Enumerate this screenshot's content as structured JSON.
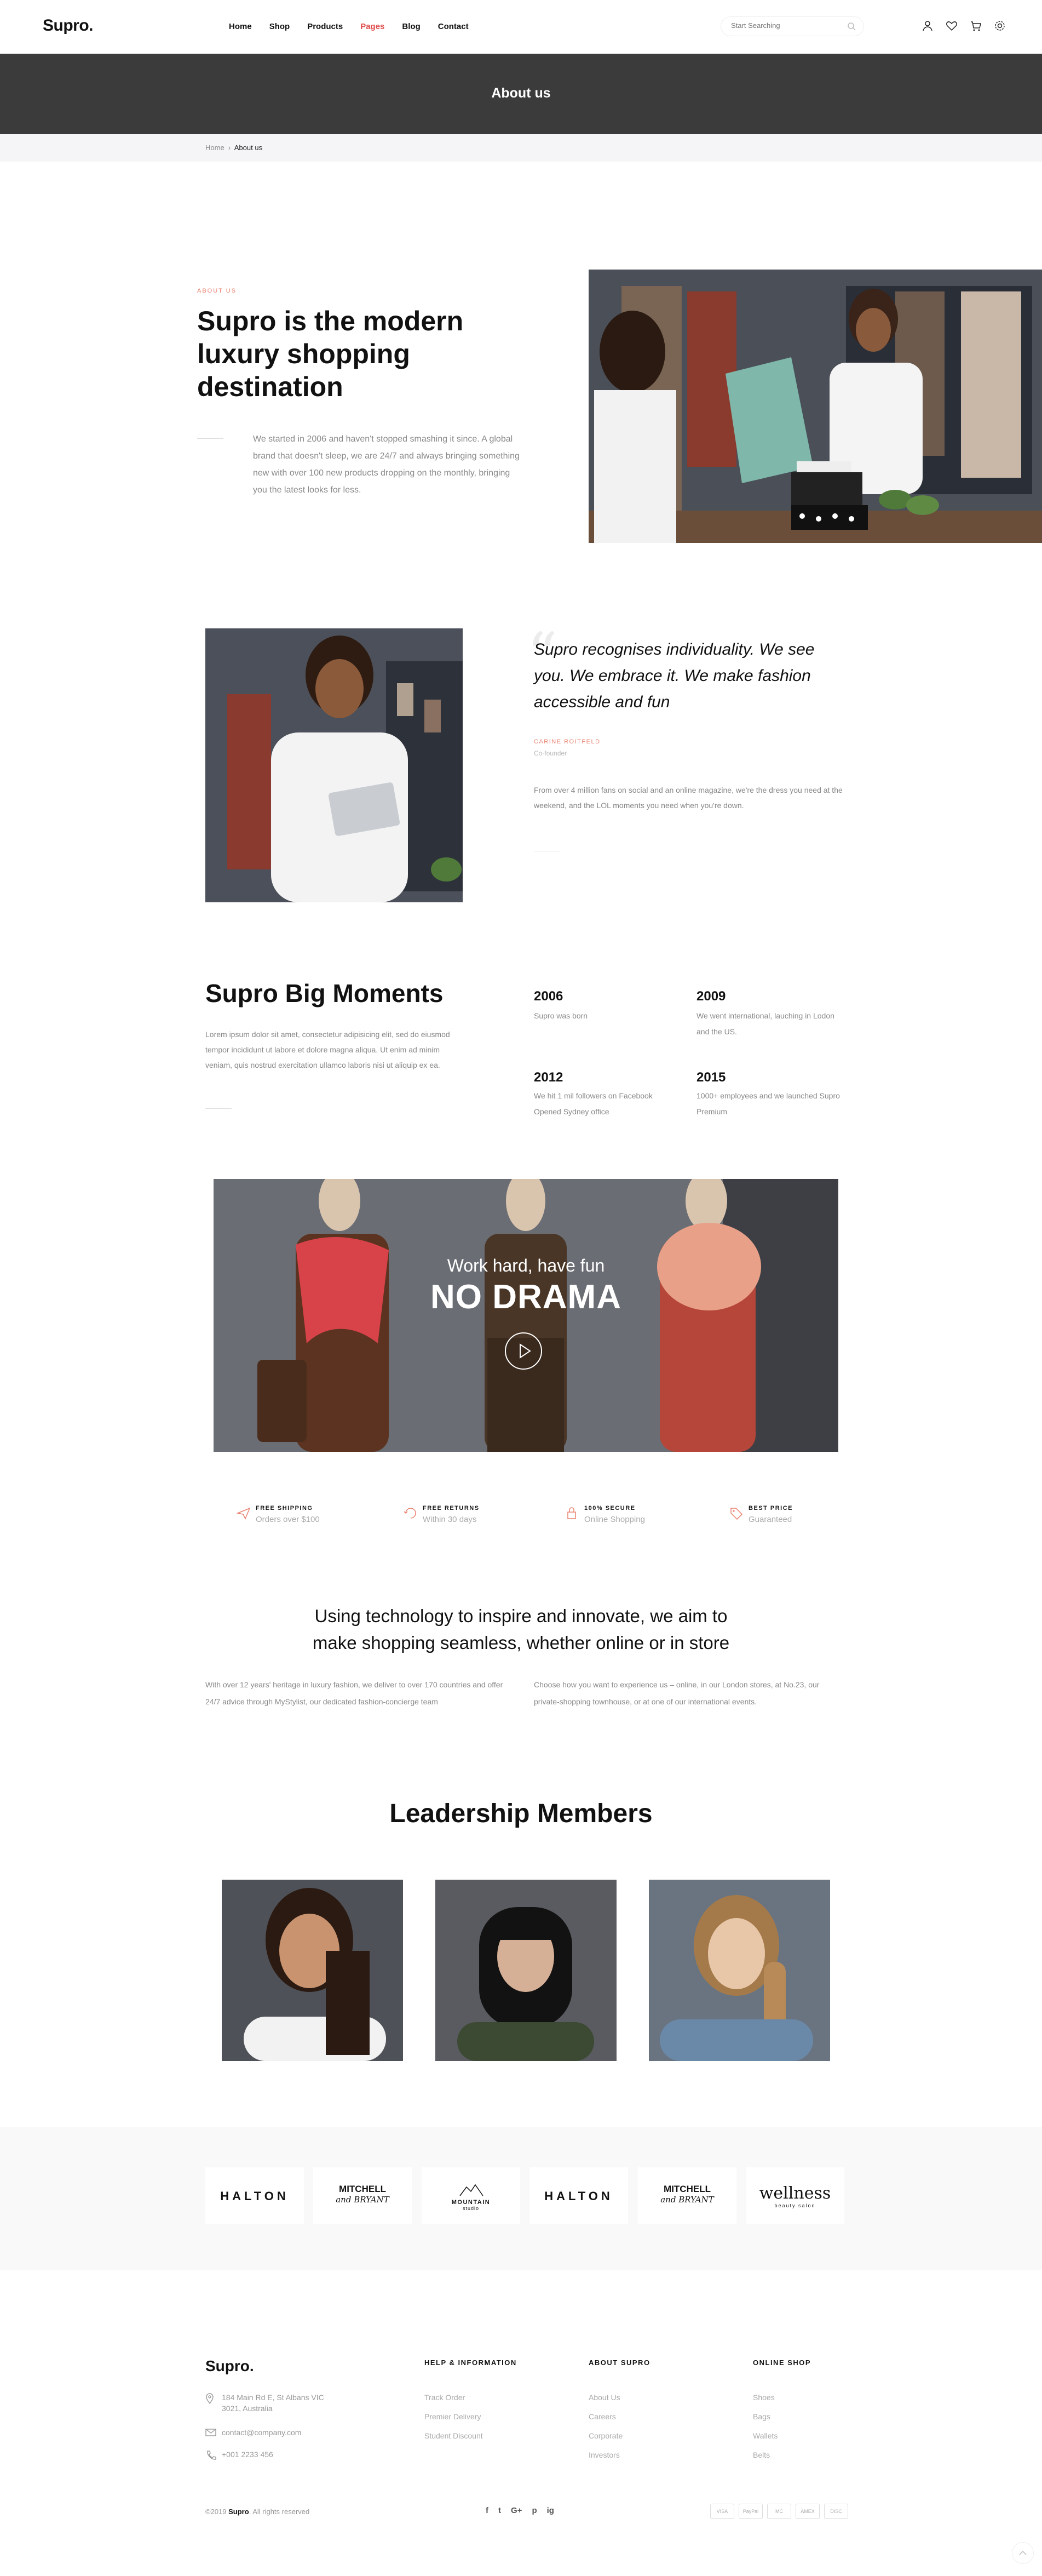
{
  "header": {
    "logo": "Supro.",
    "nav": [
      "Home",
      "Shop",
      "Products",
      "Pages",
      "Blog",
      "Contact"
    ],
    "nav_active": "Pages",
    "search_placeholder": "Start Searching",
    "icons": [
      "user-icon",
      "heart-icon",
      "cart-icon",
      "settings-icon"
    ]
  },
  "page": {
    "title": "About us",
    "breadcrumb": [
      "Home",
      "About us"
    ]
  },
  "about": {
    "eyebrow": "ABOUT US",
    "heading": "Supro is the modern luxury shopping destination",
    "body": "We started in 2006 and haven't stopped smashing it since. A global brand that doesn't sleep, we are 24/7 and always bringing something new with over 100 new products dropping on the monthly, bringing you the latest looks for less."
  },
  "quote": {
    "text": "Supro recognises individuality. We see you. We embrace it. We make fashion accessible and fun",
    "name": "CARINE ROITFELD",
    "role": "Co-founder",
    "body": "From over 4 million fans on social and an online magazine, we're the dress you need at the weekend, and the LOL moments you need when you're down."
  },
  "moments": {
    "heading": "Supro Big Moments",
    "body": "Lorem ipsum dolor sit amet, consectetur adipisicing elit, sed do eiusmod tempor incididunt ut labore et dolore magna aliqua. Ut enim ad minim veniam, quis nostrud exercitation ullamco laboris nisi ut aliquip ex ea.",
    "items": [
      {
        "year": "2006",
        "text": "Supro was born"
      },
      {
        "year": "2009",
        "text": "We went international, lauching in Lodon and the US."
      },
      {
        "year": "2012",
        "text": "We hit 1 mil followers on Facebook Opened Sydney office"
      },
      {
        "year": "2015",
        "text": "1000+ employees and we launched Supro Premium"
      }
    ]
  },
  "video": {
    "subtitle": "Work hard, have fun",
    "title": "NO DRAMA"
  },
  "features": [
    {
      "title": "FREE SHIPPING",
      "sub": "Orders over $100",
      "icon": "plane-icon"
    },
    {
      "title": "FREE RETURNS",
      "sub": "Within 30 days",
      "icon": "return-icon"
    },
    {
      "title": "100% SECURE",
      "sub": "Online Shopping",
      "icon": "lock-icon"
    },
    {
      "title": "BEST PRICE",
      "sub": "Guaranteed",
      "icon": "tag-icon"
    }
  ],
  "tech": {
    "heading": "Using technology to inspire and innovate, we aim to make shopping seamless, whether online or in store",
    "left": "With over 12 years' heritage in luxury fashion, we deliver to over 170 countries and offer 24/7 advice through MyStylist, our dedicated fashion-concierge team",
    "right": "Choose how you want to experience us – online, in our London stores, at No.23, our private-shopping townhouse, or at one of our international events."
  },
  "leadership": {
    "heading": "Leadership Members"
  },
  "brands": [
    {
      "line1": "HALTON",
      "line2": ""
    },
    {
      "line1": "MITCHELL",
      "line2": "and BRYANT"
    },
    {
      "line1": "MOUNTAIN",
      "line2": "studio"
    },
    {
      "line1": "HALTON",
      "line2": ""
    },
    {
      "line1": "MITCHELL",
      "line2": "and BRYANT"
    },
    {
      "line1": "wellness",
      "line2": "beauty salon"
    }
  ],
  "footer": {
    "logo": "Supro.",
    "address": "184 Main Rd E, St Albans VIC 3021, Australia",
    "email": "contact@company.com",
    "phone": "+001 2233 456",
    "cols": [
      {
        "heading": "HELP & INFORMATION",
        "links": [
          "Track Order",
          "Premier Delivery",
          "Student Discount"
        ]
      },
      {
        "heading": "ABOUT SUPRO",
        "links": [
          "About Us",
          "Careers",
          "Corporate",
          "Investors"
        ]
      },
      {
        "heading": "ONLINE SHOP",
        "links": [
          "Shoes",
          "Bags",
          "Wallets",
          "Belts"
        ]
      }
    ],
    "copyright_prefix": "©2019",
    "copyright_brand": "Supro",
    "copyright_suffix": ". All rights reserved",
    "social": [
      "f",
      "t",
      "G+",
      "p",
      "ig"
    ],
    "payments": [
      "VISA",
      "PayPal",
      "MC",
      "AMEX",
      "DISC"
    ]
  },
  "colors": {
    "accent": "#e14c4c",
    "eyebrow": "#e9806e",
    "band": "#3b3b3b"
  }
}
